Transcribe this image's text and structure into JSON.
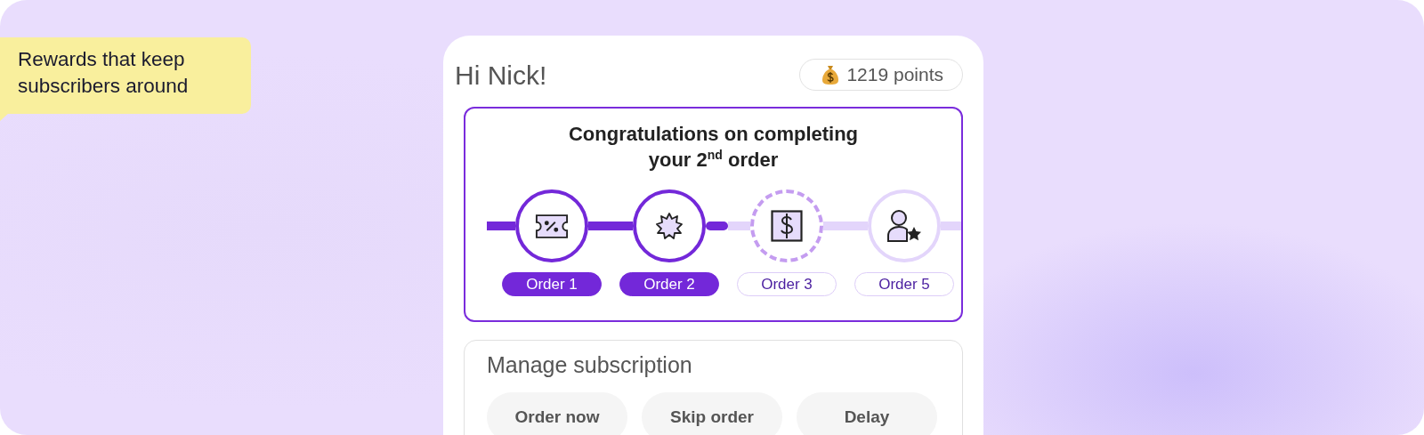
{
  "note": {
    "text": "Rewards that keep subscribers around"
  },
  "greeting": "Hi Nick!",
  "points": {
    "text": "1219 points"
  },
  "rewards": {
    "title": "Congratulations on completing your 2$^{nd}$ order",
    "milestones": [
      {
        "label": "Order 1",
        "kind": "completed"
      },
      {
        "label": "Order 2",
        "kind": "completed"
      },
      {
        "label": "Order 3",
        "kind": "next"
      },
      {
        "label": "Order 5",
        "kind": "upcoming"
      }
    ]
  },
  "manage": {
    "title": "Manage subscription",
    "buttons": [
      "Order now",
      "Skip order",
      "Delay"
    ]
  }
}
